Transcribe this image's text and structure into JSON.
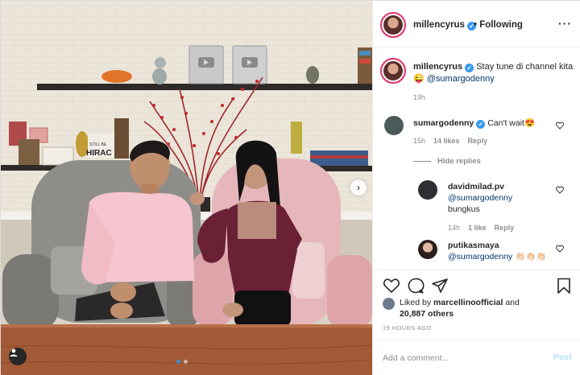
{
  "post": {
    "owner": "millencyrus",
    "follow_status": "Following",
    "more_icon": "more-horizontal-icon"
  },
  "caption": {
    "username": "millencyrus",
    "text": "Stay tune di channel kita",
    "emoji": "😜",
    "mention": "@sumargodenny",
    "time": "19h"
  },
  "comments": [
    {
      "username": "sumargodenny",
      "verified": true,
      "text": "Can't wait",
      "emoji": "😍",
      "time": "15h",
      "likes": "14 likes",
      "reply_label": "Reply"
    }
  ],
  "hide_replies_label": "Hide replies",
  "replies": [
    {
      "username": "davidmilad.pv",
      "mention": "@sumargodenny",
      "text": "bungkus",
      "time": "14h",
      "likes": "1 like",
      "reply_label": "Reply"
    },
    {
      "username": "putikasmaya",
      "mention": "@sumargodenny",
      "text": "👏🏻👏🏻👏🏻"
    }
  ],
  "likes": {
    "prefix": "Liked by",
    "user": "marcellinoofficial",
    "joiner": "and",
    "others": "20,887 others"
  },
  "timestamp": "19 HOURS AGO",
  "add_comment": {
    "placeholder": "Add a comment...",
    "post_label": "Post"
  },
  "photo": {
    "next_arrow": "›",
    "carousel_dots": 2,
    "active_dot": 0,
    "shelf_sign": "STILL BE\nHIRAC"
  },
  "colors": {
    "accent_blue": "#3897f0",
    "post_disabled": "#b2dffc",
    "story_ring": "#e1306c",
    "muted": "#8e8e8e"
  }
}
